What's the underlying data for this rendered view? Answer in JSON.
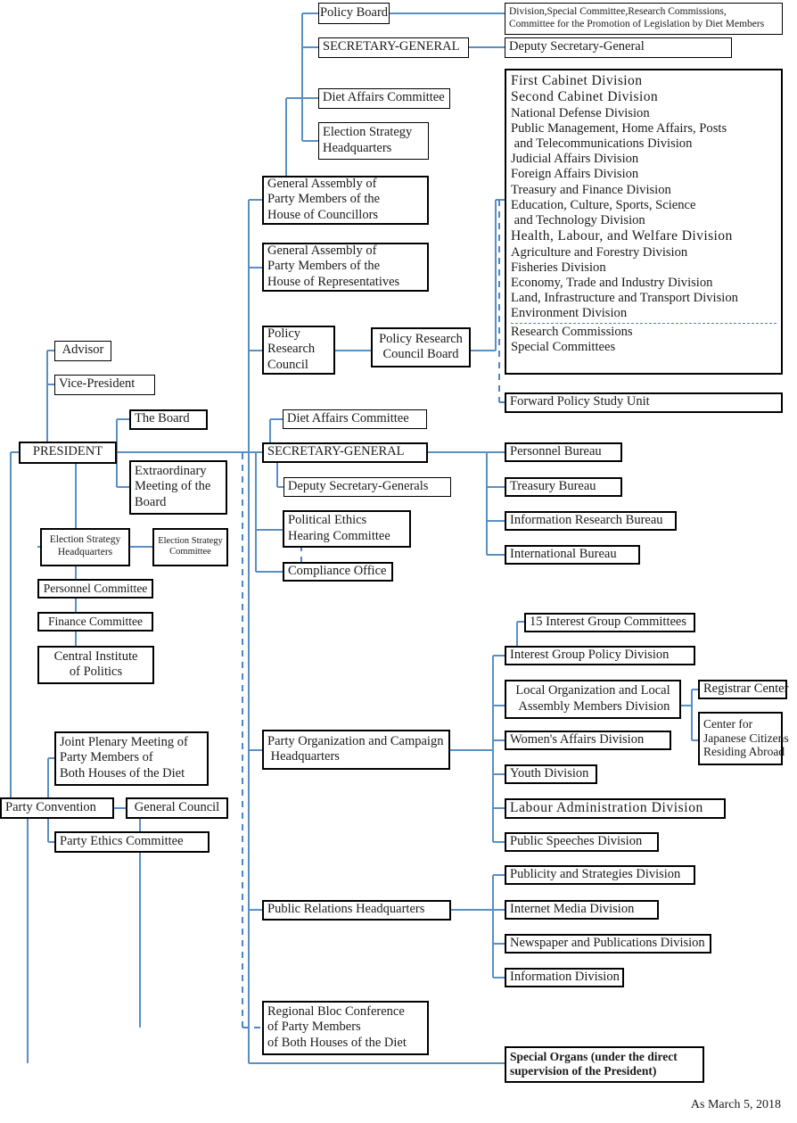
{
  "meta": {
    "footer_note": "As March 5, 2018",
    "line_color": "#5a8fc4",
    "box_border_color": "#000000",
    "background": "#ffffff"
  },
  "nodes": {
    "policy_board": {
      "label": "Policy Board"
    },
    "policy_board_detail": {
      "lines": [
        "Division,Special Committee,Research Commissions,",
        "Committee for the Promotion of Legislation by Diet Members"
      ]
    },
    "secretary_general_upper": {
      "label": "SECRETARY-GENERAL"
    },
    "deputy_secretary_general": {
      "label": "Deputy Secretary-General"
    },
    "diet_affairs_committee_upper": {
      "label": "Diet Affairs Committee"
    },
    "election_strategy_hq_upper": {
      "lines": [
        "Election Strategy",
        "Headquarters"
      ]
    },
    "general_assembly_councillors": {
      "lines": [
        "General Assembly of",
        "Party Members of the",
        "House of Councillors"
      ]
    },
    "general_assembly_representatives": {
      "lines": [
        "General Assembly of",
        "Party Members of the",
        "House of Representatives"
      ]
    },
    "policy_research_council": {
      "lines": [
        "Policy",
        "Research",
        "Council"
      ]
    },
    "policy_research_council_board": {
      "lines": [
        "Policy Research",
        "Council Board"
      ]
    },
    "divisions_box": {
      "lines": [
        "First Cabinet Division",
        "Second Cabinet Division",
        "National Defense Division",
        "Public Management, Home Affairs, Posts",
        " and Telecommunications Division",
        "Judicial Affairs Division",
        "Foreign Affairs Division",
        "Treasury and Finance Division",
        "Education, Culture, Sports, Science",
        " and Technology Division",
        "Health, Labour, and Welfare Division",
        "Agriculture and Forestry Division",
        "Fisheries Division",
        "Economy, Trade and Industry Division",
        "Land, Infrastructure and Transport Division",
        "Environment Division",
        "Research Commissions",
        "Special Committees"
      ],
      "separator_after_index": 15,
      "emphasized_indexes": [
        0,
        1,
        10
      ]
    },
    "forward_policy_study_unit": {
      "label": "Forward Policy Study Unit"
    },
    "advisor": {
      "label": "Advisor"
    },
    "vice_president": {
      "label": "Vice-President"
    },
    "president": {
      "label": "PRESIDENT"
    },
    "the_board": {
      "label": "The Board"
    },
    "extraordinary_meeting": {
      "lines": [
        "Extraordinary",
        "Meeting of the",
        "Board"
      ]
    },
    "election_strategy_hq_pres": {
      "lines": [
        "Election Strategy",
        "Headquarters"
      ]
    },
    "election_strategy_committee": {
      "lines": [
        "Election Strategy",
        "Committee"
      ]
    },
    "personnel_committee": {
      "label": "Personnel Committee"
    },
    "finance_committee": {
      "label": "Finance Committee"
    },
    "central_institute_of_politics": {
      "lines": [
        "Central Institute",
        "of Politics"
      ]
    },
    "diet_affairs_committee_lower": {
      "label": "Diet Affairs Committee"
    },
    "secretary_general_lower": {
      "label": "SECRETARY-GENERAL"
    },
    "deputy_secretary_generals": {
      "label": "Deputy Secretary-Generals"
    },
    "political_ethics_hearing_committee": {
      "lines": [
        "Political Ethics",
        "Hearing Committee"
      ]
    },
    "compliance_office": {
      "label": "Compliance Office"
    },
    "personnel_bureau": {
      "label": "Personnel Bureau"
    },
    "treasury_bureau": {
      "label": "Treasury Bureau"
    },
    "information_research_bureau": {
      "label": "Information Research Bureau"
    },
    "international_bureau": {
      "label": "International Bureau"
    },
    "interest_group_committees": {
      "label": "15 Interest Group Committees"
    },
    "interest_group_policy_division": {
      "label": "Interest Group Policy Division"
    },
    "local_organization_division": {
      "lines": [
        "Local Organization and Local",
        " Assembly Members Division"
      ]
    },
    "registrar_center": {
      "label": "Registrar Center"
    },
    "center_japanese_citizens": {
      "lines": [
        "Center for",
        "Japanese Citizens",
        "Residing Abroad"
      ]
    },
    "womens_affairs_division": {
      "label": "Women's Affairs Division"
    },
    "youth_division": {
      "label": "Youth Division"
    },
    "labour_administration_division": {
      "label": "Labour Administration Division"
    },
    "public_speeches_division": {
      "label": "Public Speeches Division"
    },
    "party_organization_campaign_hq": {
      "lines": [
        "Party Organization and Campaign",
        " Headquarters"
      ]
    },
    "publicity_strategies_division": {
      "label": "Publicity and Strategies Division"
    },
    "internet_media_division": {
      "label": "Internet Media Division"
    },
    "newspaper_publications_division": {
      "label": "Newspaper and Publications Division"
    },
    "information_division": {
      "label": "Information Division"
    },
    "public_relations_hq": {
      "label": "Public Relations Headquarters"
    },
    "joint_plenary_meeting": {
      "lines": [
        "Joint Plenary Meeting of",
        "Party Members of",
        "Both Houses of the Diet"
      ]
    },
    "party_convention": {
      "label": "Party Convention"
    },
    "general_council": {
      "label": "General Council"
    },
    "party_ethics_committee": {
      "label": "Party Ethics Committee"
    },
    "regional_bloc_conference": {
      "lines": [
        "Regional Bloc Conference",
        "of Party Members",
        "of Both Houses of the Diet"
      ]
    },
    "special_organs": {
      "lines": [
        "Special Organs (under the direct",
        "supervision of the President)"
      ]
    }
  }
}
